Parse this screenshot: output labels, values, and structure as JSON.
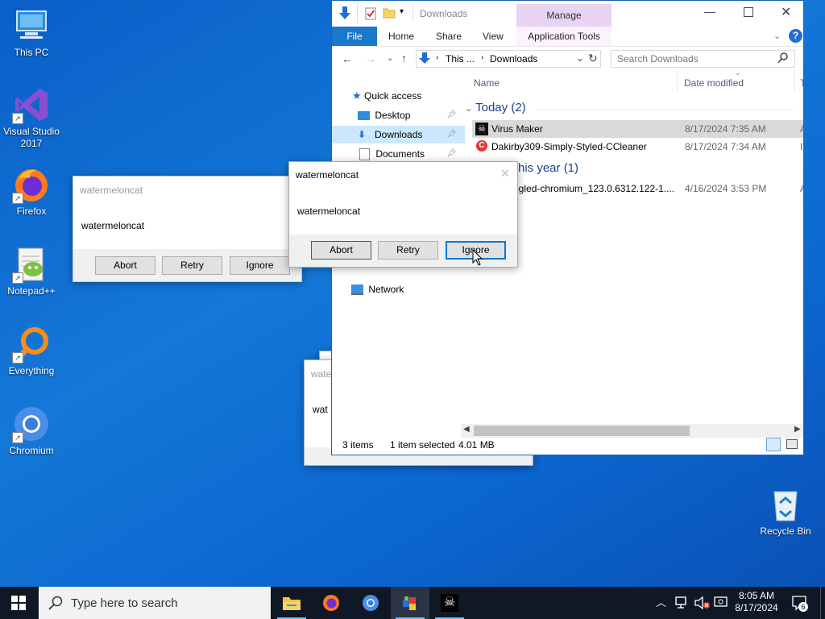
{
  "desktop": {
    "icons": [
      {
        "label": "This PC"
      },
      {
        "label": "Visual Studio 2017"
      },
      {
        "label": "Firefox"
      },
      {
        "label": "Notepad++"
      },
      {
        "label": "Everything"
      },
      {
        "label": "Chromium"
      },
      {
        "label": "Recycle Bin"
      }
    ]
  },
  "explorer": {
    "title": "Downloads",
    "context_tab": "Manage",
    "ribbon_tabs": [
      "File",
      "Home",
      "Share",
      "View",
      "Application Tools"
    ],
    "breadcrumb": [
      "This ...",
      "Downloads"
    ],
    "search_placeholder": "Search Downloads",
    "columns": {
      "name": "Name",
      "date": "Date modified",
      "type": "T"
    },
    "nav": {
      "quick_access": "Quick access",
      "desktop": "Desktop",
      "downloads": "Downloads",
      "documents": "Documents",
      "network": "Network"
    },
    "groups": [
      {
        "label": "Today (2)"
      },
      {
        "label": "his year (1)"
      }
    ],
    "files": [
      {
        "name": "Virus Maker",
        "date": "8/17/2024 7:35 AM",
        "type": "A"
      },
      {
        "name": "Dakirby309-Simply-Styled-CCleaner",
        "date": "8/17/2024 7:34 AM",
        "type": "I"
      },
      {
        "name": "ogled-chromium_123.0.6312.122-1....",
        "date": "4/16/2024 3:53 PM",
        "type": "A"
      }
    ],
    "status": {
      "items": "3 items",
      "selected": "1 item selected",
      "size": "4.01 MB"
    }
  },
  "dialogs": {
    "left": {
      "title": "watermeloncat",
      "message": "watermeloncat",
      "abort": "Abort",
      "retry": "Retry",
      "ignore": "Ignore"
    },
    "front": {
      "title": "watermeloncat",
      "message": "watermeloncat",
      "abort": "Abort",
      "retry": "Retry",
      "ignore": "Ignore"
    },
    "back": {
      "title": "wate",
      "message": "wat"
    }
  },
  "taskbar": {
    "search_placeholder": "Type here to search",
    "time": "8:05 AM",
    "date": "8/17/2024",
    "notification_count": "6"
  },
  "colors": {
    "desktop_bg": "#0b66cf",
    "accent": "#0078d7",
    "context_tab": "#e8d3f2",
    "taskbar": "#101826",
    "selected_row": "#d9d9d9"
  }
}
